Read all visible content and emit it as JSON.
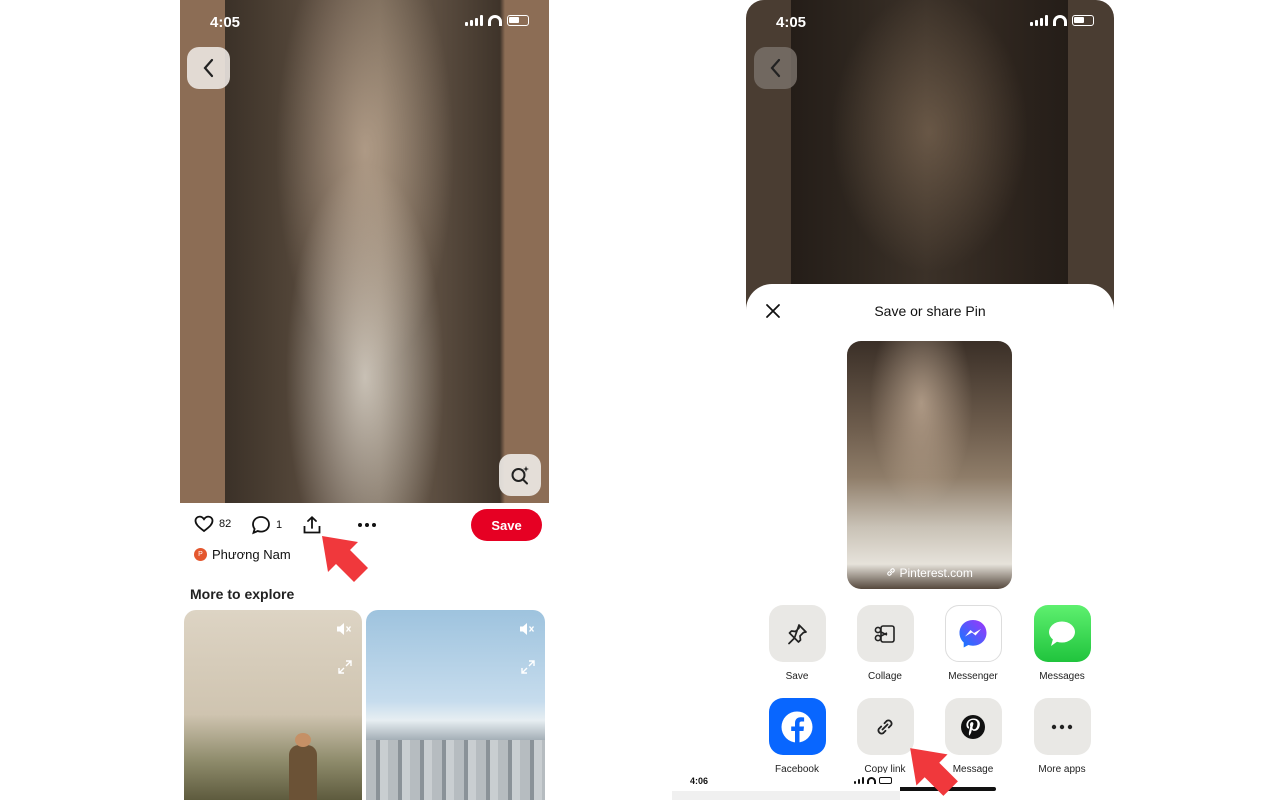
{
  "left": {
    "status": {
      "time": "4:05"
    },
    "actions": {
      "likes": "82",
      "comments": "1",
      "save_label": "Save"
    },
    "author": {
      "initial": "P",
      "name": "Phương Nam"
    },
    "more_title": "More to explore"
  },
  "right": {
    "status": {
      "time": "4:05"
    },
    "sheet": {
      "title": "Save or share Pin",
      "preview_url": "Pinterest.com",
      "options": [
        {
          "label": "Save",
          "icon": "pin-icon"
        },
        {
          "label": "Collage",
          "icon": "scissors-icon"
        },
        {
          "label": "Messenger",
          "icon": "messenger-icon"
        },
        {
          "label": "Messages",
          "icon": "messages-icon"
        },
        {
          "label": "Facebook",
          "icon": "facebook-icon"
        },
        {
          "label": "Copy link",
          "icon": "link-icon"
        },
        {
          "label": "Message",
          "icon": "pinterest-icon"
        },
        {
          "label": "More apps",
          "icon": "more-icon"
        }
      ]
    }
  },
  "overlay": {
    "time": "4:06"
  },
  "colors": {
    "pinterest_red": "#e60023",
    "facebook_blue": "#0866ff",
    "messages_green": "#2bd14a",
    "arrow_red": "#f0383c"
  }
}
